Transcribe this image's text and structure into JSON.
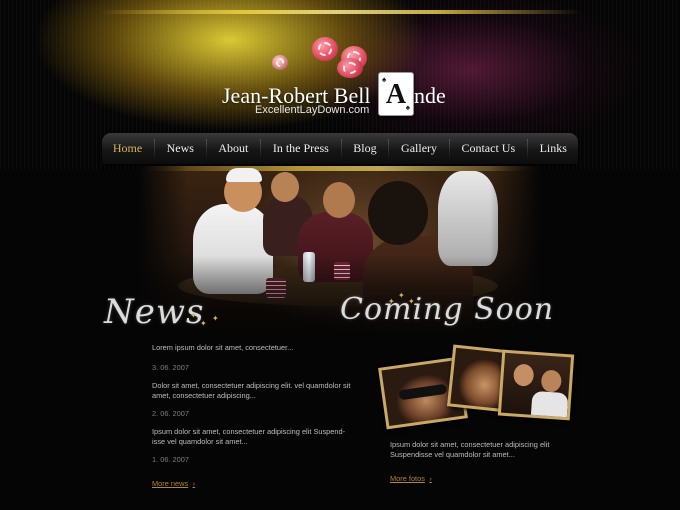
{
  "brand": {
    "name_part1": "Jean-Robert Bell",
    "card_letter": "A",
    "name_part2": "nde",
    "url": "ExcellentLayDown.com"
  },
  "nav": [
    {
      "label": "Home",
      "active": true
    },
    {
      "label": "News"
    },
    {
      "label": "About"
    },
    {
      "label": "In the Press"
    },
    {
      "label": "Blog"
    },
    {
      "label": "Gallery"
    },
    {
      "label": "Contact Us"
    },
    {
      "label": "Links"
    }
  ],
  "news": {
    "title": "News",
    "items": [
      {
        "text": "Lorem ipsum dolor sit amet, consectetuer...",
        "date": "3. 06. 2007"
      },
      {
        "text": "Dolor sit amet, consectetuer adipiscing elit. vel quamdolor sit amet, consectetuer adipiscing...",
        "date": "2. 06. 2007"
      },
      {
        "text": "Ipsum dolor sit amet, consectetuer adipiscing elit Suspend-isse vel quamdolor sit amet...",
        "date": "1. 06. 2007"
      }
    ],
    "more_label": "More news"
  },
  "coming": {
    "title": "Coming Soon",
    "text": "Ipsum dolor sit amet, consectetuer adipiscing elit Suspendisse vel quamdolor sit amet...",
    "more_label": "More fotos"
  },
  "colors": {
    "accent": "#d7b25a",
    "link": "#b0862f",
    "background": "#050505"
  },
  "icons": [
    "poker-chip-icon",
    "playing-card-icon",
    "arrow-right-icon",
    "star-icon"
  ]
}
